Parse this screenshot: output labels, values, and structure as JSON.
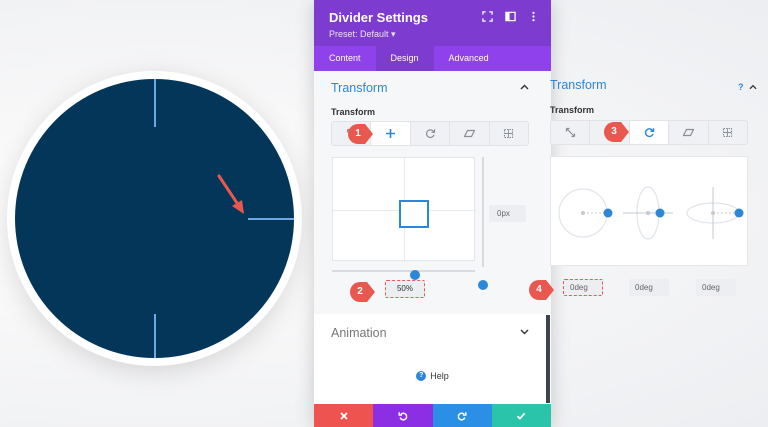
{
  "panel": {
    "title": "Divider Settings",
    "preset": "Preset: Default ▾",
    "tabs": [
      {
        "label": "Content",
        "active": false
      },
      {
        "label": "Design",
        "active": true
      },
      {
        "label": "Advanced",
        "active": false
      }
    ]
  },
  "transform": {
    "title": "Transform",
    "sublabel": "Transform",
    "tools": [
      "scale-icon",
      "translate-icon",
      "rotate-icon",
      "skew-icon",
      "origin-icon"
    ],
    "active_tool": "translate",
    "y_value": "0px",
    "x_value": "50%"
  },
  "animation": {
    "title": "Animation",
    "help": "Help"
  },
  "right_transform": {
    "title": "Transform",
    "sublabel": "Transform",
    "active_tool": "rotate",
    "rotate_x": "0deg",
    "rotate_y": "0deg",
    "rotate_z": "0deg"
  },
  "badges": [
    "1",
    "2",
    "3",
    "4"
  ],
  "colors": {
    "circle_fill": "#04365a",
    "tick_line": "#6aa9e6",
    "header_purple": "#7e3bd0",
    "tabs_purple": "#8f42ec",
    "accent_blue": "#2b87da",
    "badge_red": "#e8584f",
    "cancel_red": "#ef5350",
    "undo_purple": "#8c2ee3",
    "redo_blue": "#2c8fe6",
    "save_teal": "#29c4a9"
  }
}
